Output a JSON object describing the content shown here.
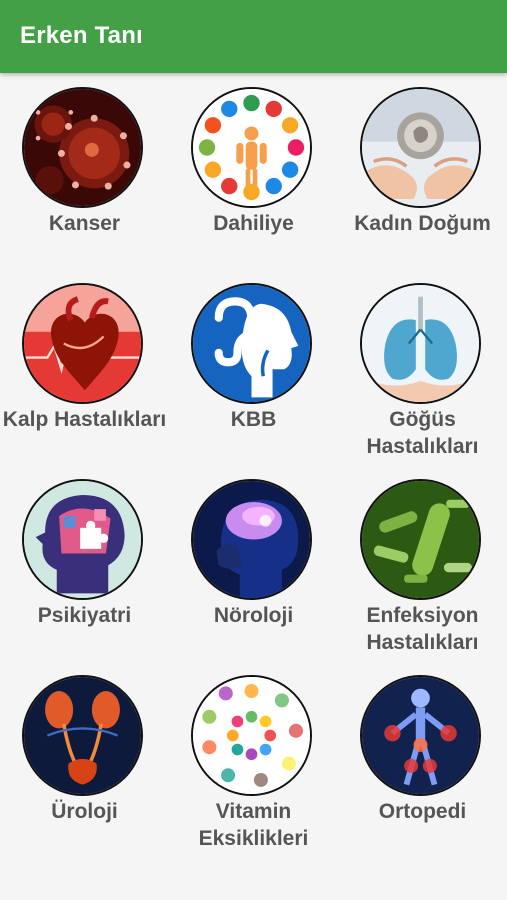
{
  "app": {
    "title": "Erken Tanı"
  },
  "categories": [
    {
      "label": "Kanser",
      "icon": "virus-cells-icon"
    },
    {
      "label": "Dahiliye",
      "icon": "internal-organs-icon"
    },
    {
      "label": "Kadın Doğum",
      "icon": "fetus-in-hands-icon"
    },
    {
      "label": "Kalp Hastalıkları",
      "icon": "heart-icon"
    },
    {
      "label": "KBB",
      "icon": "ear-nose-throat-icon"
    },
    {
      "label": "Göğüs Hastalıkları",
      "icon": "lungs-icon"
    },
    {
      "label": "Psikiyatri",
      "icon": "puzzle-head-icon"
    },
    {
      "label": "Nöroloji",
      "icon": "brain-icon"
    },
    {
      "label": "Enfeksiyon Hastalıkları",
      "icon": "bacteria-icon"
    },
    {
      "label": "Üroloji",
      "icon": "urinary-system-icon"
    },
    {
      "label": "Vitamin Eksiklikleri",
      "icon": "vitamins-icon"
    },
    {
      "label": "Ortopedi",
      "icon": "skeleton-joints-icon"
    }
  ],
  "colors": {
    "appbar": "#43a047",
    "label": "#555555",
    "background": "#f5f5f5"
  }
}
